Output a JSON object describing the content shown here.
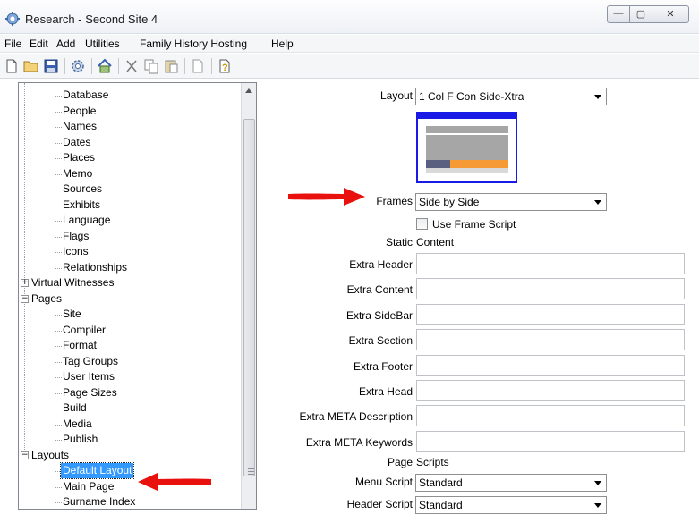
{
  "window": {
    "title": "Research - Second Site 4",
    "min_glyph": "—",
    "max_glyph": "▢",
    "close_glyph": "✕"
  },
  "menu": [
    "File",
    "Edit",
    "Add",
    "Utilities",
    "Family History Hosting",
    "Help"
  ],
  "toolbar": {
    "icons": [
      "new-file-icon",
      "open-folder-icon",
      "save-icon",
      "settings-gear-icon",
      "home-icon",
      "cut-icon",
      "copy-icon",
      "paste-icon",
      "blank-page-icon",
      "help-icon"
    ]
  },
  "tree": {
    "items": [
      {
        "label": "Database",
        "level": 2
      },
      {
        "label": "People",
        "level": 2
      },
      {
        "label": "Names",
        "level": 2
      },
      {
        "label": "Dates",
        "level": 2
      },
      {
        "label": "Places",
        "level": 2
      },
      {
        "label": "Memo",
        "level": 2
      },
      {
        "label": "Sources",
        "level": 2
      },
      {
        "label": "Exhibits",
        "level": 2
      },
      {
        "label": "Language",
        "level": 2
      },
      {
        "label": "Flags",
        "level": 2
      },
      {
        "label": "Icons",
        "level": 2
      },
      {
        "label": "Relationships",
        "level": 2
      },
      {
        "label": "Virtual Witnesses",
        "level": 1,
        "expander": "+"
      },
      {
        "label": "Pages",
        "level": 1,
        "expander": "−"
      },
      {
        "label": "Site",
        "level": 2
      },
      {
        "label": "Compiler",
        "level": 2
      },
      {
        "label": "Format",
        "level": 2
      },
      {
        "label": "Tag Groups",
        "level": 2
      },
      {
        "label": "User Items",
        "level": 2
      },
      {
        "label": "Page Sizes",
        "level": 2
      },
      {
        "label": "Build",
        "level": 2
      },
      {
        "label": "Media",
        "level": 2
      },
      {
        "label": "Publish",
        "level": 2
      },
      {
        "label": "Layouts",
        "level": 1,
        "expander": "−"
      },
      {
        "label": "Default Layout",
        "level": 2,
        "selected": true
      },
      {
        "label": "Main Page",
        "level": 2
      },
      {
        "label": "Surname Index",
        "level": 2
      }
    ]
  },
  "form": {
    "layout_label": "Layout",
    "layout_value": "1 Col F Con Side-Xtra",
    "frames_label": "Frames",
    "frames_value": "Side by Side",
    "use_frame_script": "Use Frame Script",
    "static_content_label": "Static",
    "static_content_value": "Content",
    "text_fields": [
      "Extra Header",
      "Extra Content",
      "Extra SideBar",
      "Extra Section",
      "Extra Footer",
      "Extra Head",
      "Extra META Description",
      "Extra META Keywords"
    ],
    "page_scripts_label": "Page",
    "page_scripts_value": "Scripts",
    "menu_script_label": "Menu Script",
    "menu_script_value": "Standard",
    "header_script_label": "Header Script",
    "header_script_value": "Standard"
  },
  "colors": {
    "selection": "#3399ff",
    "preview_border": "#1a1ae6",
    "preview_header": "#1a1ae6",
    "preview_gray": "#a6a6a6",
    "preview_dark": "#5a6080",
    "preview_orange": "#f59a35",
    "arrow_red": "#e8110e"
  }
}
